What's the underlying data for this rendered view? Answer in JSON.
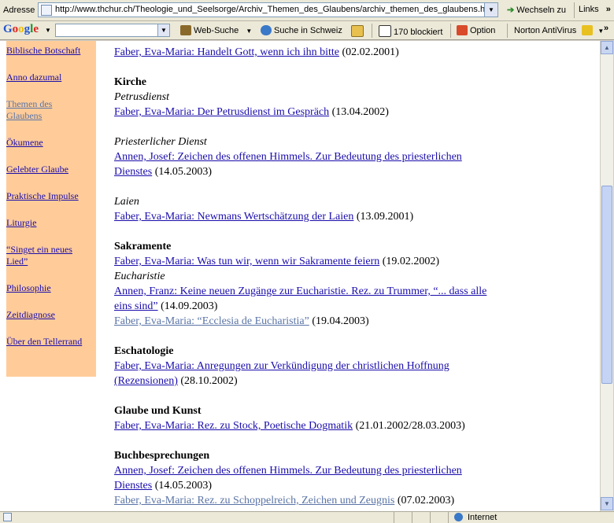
{
  "address_bar": {
    "label": "Adresse",
    "url": "http://www.thchur.ch/Theologie_und_Seelsorge/Archiv_Themen_des_Glaubens/archiv_themen_des_glaubens.ht",
    "go_label": "Wechseln zu",
    "links_label": "Links",
    "overflow": "»"
  },
  "google_toolbar": {
    "logo": "Google",
    "logo_colors": [
      "#2255cc",
      "#dd2222",
      "#eebb00",
      "#2255cc",
      "#119933",
      "#dd2222"
    ],
    "web_search": "Web-Suche",
    "search_ch": "Suche in Schweiz",
    "blocked": "170 blockiert",
    "options": "Option",
    "norton": "Norton AntiVirus",
    "overflow": "»"
  },
  "sidebar": {
    "items": [
      {
        "label": "Biblische Botschaft",
        "visited": false
      },
      {
        "label": "Anno dazumal",
        "visited": false
      },
      {
        "label": "Themen des Glaubens",
        "visited": true
      },
      {
        "label": "Ökumene",
        "visited": false
      },
      {
        "label": "Gelebter Glaube",
        "visited": false
      },
      {
        "label": "Praktische Impulse",
        "visited": false
      },
      {
        "label": "Liturgie",
        "visited": false
      },
      {
        "label": "“Singet ein neues Lied”",
        "visited": false
      },
      {
        "label": "Philosophie",
        "visited": false
      },
      {
        "label": "Zeitdiagnose",
        "visited": false
      },
      {
        "label": "Über den Tellerrand",
        "visited": false
      }
    ]
  },
  "content": {
    "rows": [
      {
        "kind": "entry",
        "link": "Faber, Eva-Maria: Handelt Gott, wenn ich ihn bitte",
        "suffix": " (02.02.2001)",
        "visited": false
      },
      {
        "kind": "heading",
        "text": "Kirche"
      },
      {
        "kind": "sub",
        "text": "Petrusdienst"
      },
      {
        "kind": "entry",
        "link": "Faber, Eva-Maria: Der Petrusdienst im Gespräch",
        "suffix": " (13.04.2002)",
        "visited": false
      },
      {
        "kind": "sub",
        "text": "Priesterlicher Dienst"
      },
      {
        "kind": "entry",
        "link": "Annen, Josef: Zeichen des offenen Himmels. Zur Bedeutung des priesterlichen",
        "suffix": "",
        "visited": false
      },
      {
        "kind": "entry",
        "link": "Dienstes",
        "suffix": " (14.05.2003)",
        "visited": false
      },
      {
        "kind": "sub",
        "text": "Laien"
      },
      {
        "kind": "entry",
        "link": "Faber, Eva-Maria: Newmans Wertschätzung der Laien",
        "suffix": " (13.09.2001)",
        "visited": false
      },
      {
        "kind": "heading",
        "text": "Sakramente"
      },
      {
        "kind": "entry",
        "link": "Faber, Eva-Maria: Was tun wir, wenn wir Sakramente feiern",
        "suffix": " (19.02.2002)",
        "visited": false
      },
      {
        "kind": "sub",
        "text": "Eucharistie"
      },
      {
        "kind": "entry",
        "link": "Annen, Franz: Keine neuen Zugänge zur Eucharistie. Rez. zu Trummer, “... dass alle",
        "suffix": "",
        "visited": false
      },
      {
        "kind": "entry",
        "link": "eins sind”",
        "suffix": " (14.09.2003)",
        "visited": false
      },
      {
        "kind": "entry",
        "link": "Faber, Eva-Maria: “Ecclesia de Eucharistia”",
        "suffix": " (19.04.2003)",
        "visited": true
      },
      {
        "kind": "heading",
        "text": "Eschatologie"
      },
      {
        "kind": "entry",
        "link": "Faber, Eva-Maria: Anregungen zur Verkündigung der christlichen Hoffnung",
        "suffix": "",
        "visited": false
      },
      {
        "kind": "entry",
        "link": "(Rezensionen)",
        "suffix": " (28.10.2002)",
        "visited": false
      },
      {
        "kind": "heading",
        "text": "Glaube und Kunst"
      },
      {
        "kind": "entry",
        "link": "Faber, Eva-Maria: Rez. zu Stock, Poetische Dogmatik",
        "suffix": " (21.01.2002/28.03.2003)",
        "visited": false
      },
      {
        "kind": "heading",
        "text": "Buchbesprechungen"
      },
      {
        "kind": "entry",
        "link": "Annen, Josef: Zeichen des offenen Himmels. Zur Bedeutung des priesterlichen",
        "suffix": "",
        "visited": false
      },
      {
        "kind": "entry",
        "link": "Dienstes",
        "suffix": " (14.05.2003)",
        "visited": false
      },
      {
        "kind": "entry",
        "link": "Faber, Eva-Maria: Rez. zu Schoppelreich, Zeichen und Zeugnis",
        "suffix": " (07.02.2003)",
        "visited": true
      }
    ]
  },
  "status_bar": {
    "zone": "Internet"
  },
  "colors": {
    "sidebar_bg": "#ffcc99",
    "link": "#1a0dab",
    "visited_link": "#5a74a6"
  }
}
